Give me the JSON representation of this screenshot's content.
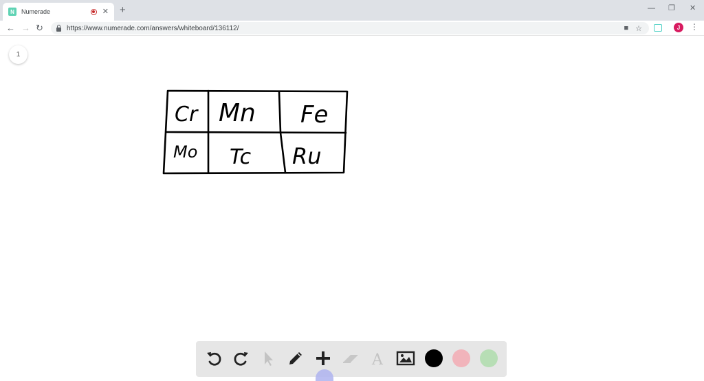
{
  "browser": {
    "tab": {
      "title": "Numerade",
      "favicon_letter": "N",
      "close": "✕"
    },
    "new_tab": "+",
    "window_controls": {
      "minimize": "—",
      "restore": "❐",
      "close": "✕"
    },
    "nav": {
      "back": "←",
      "forward": "→",
      "reload": "↻"
    },
    "url": "https://www.numerade.com/answers/whiteboard/136112/",
    "omnibox_icons": [
      "camera-icon",
      "star-icon"
    ],
    "profile_initial": "J",
    "menu": "⋮"
  },
  "whiteboard": {
    "page_number": "1",
    "table": {
      "rows": [
        [
          "Cr",
          "Mn",
          "Fe"
        ],
        [
          "Mo",
          "Tc",
          "Ru"
        ]
      ]
    }
  },
  "tools": [
    {
      "name": "undo-icon"
    },
    {
      "name": "redo-icon"
    },
    {
      "name": "select-cursor-icon",
      "disabled": true
    },
    {
      "name": "pencil-icon"
    },
    {
      "name": "plus-icon"
    },
    {
      "name": "eraser-icon",
      "disabled": true
    },
    {
      "name": "text-icon",
      "label": "A",
      "disabled": true
    },
    {
      "name": "image-icon"
    }
  ],
  "colors": {
    "black": "#000000",
    "pink": "#f1b4bb",
    "green": "#b7deb5",
    "accent_teal": "#5fd3b4",
    "profile": "#d81b60",
    "active_tool_indicator": "#aeb3ee"
  }
}
